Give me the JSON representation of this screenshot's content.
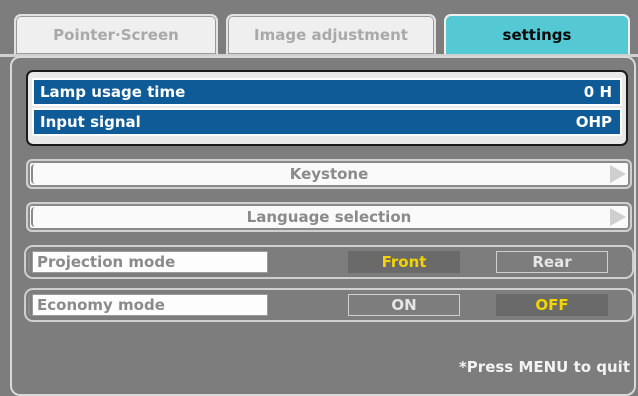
{
  "tabs": [
    {
      "label": "Pointer·Screen",
      "active": false
    },
    {
      "label": "Image adjustment",
      "active": false
    },
    {
      "label": "settings",
      "active": true
    }
  ],
  "info": {
    "lamp_label": "Lamp usage time",
    "lamp_value": "0 H",
    "input_label": "Input signal",
    "input_value": "OHP"
  },
  "menu": {
    "keystone": "Keystone",
    "language": "Language selection"
  },
  "projection_mode": {
    "label": "Projection mode",
    "options": [
      "Front",
      "Rear"
    ],
    "selected": "Front"
  },
  "economy_mode": {
    "label": "Economy mode",
    "options": [
      "ON",
      "OFF"
    ],
    "selected": "OFF"
  },
  "footer": "*Press MENU to quit",
  "colors": {
    "background": "#7d7d7d",
    "active_tab": "#54c8d3",
    "info_row": "#0f5b98",
    "selected_text": "#f2d400"
  }
}
